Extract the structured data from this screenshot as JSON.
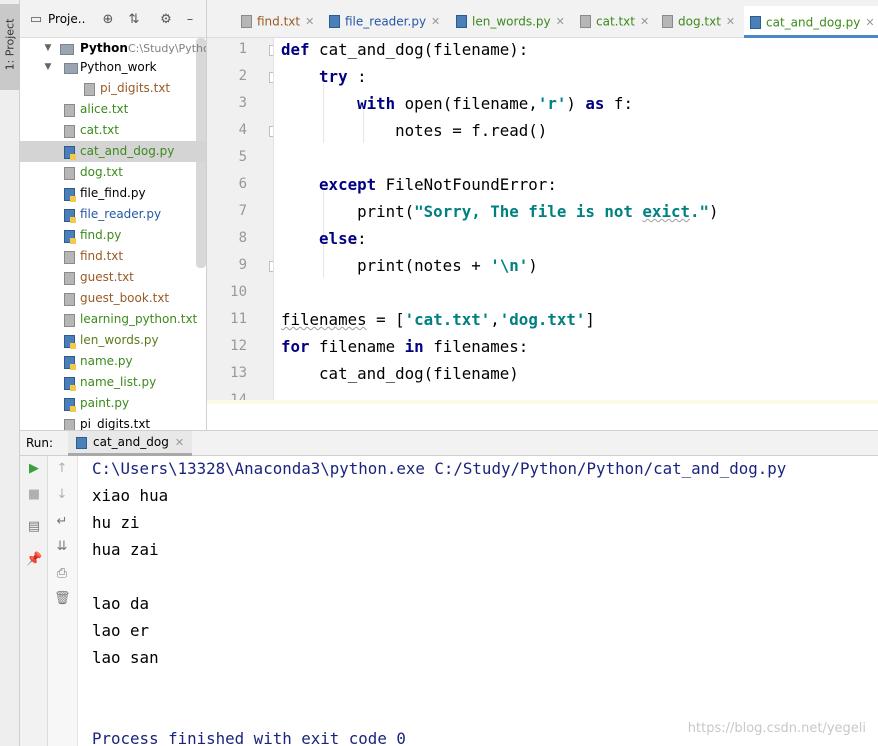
{
  "sidebar": {
    "tab_label": "1: Project"
  },
  "project_panel": {
    "title": "Proje..",
    "tree": [
      {
        "label": "Python",
        "extra": "C:\\Study\\Python\\",
        "kind": "root"
      },
      {
        "label": "Python_work",
        "kind": "folder"
      },
      {
        "label": "pi_digits.txt",
        "kind": "txt"
      },
      {
        "label": "alice.txt",
        "kind": "txt"
      },
      {
        "label": "cat.txt",
        "kind": "txt"
      },
      {
        "label": "cat_and_dog.py",
        "kind": "py",
        "selected": true
      },
      {
        "label": "dog.txt",
        "kind": "txt"
      },
      {
        "label": "file_find.py",
        "kind": "py"
      },
      {
        "label": "file_reader.py",
        "kind": "py"
      },
      {
        "label": "find.py",
        "kind": "py"
      },
      {
        "label": "find.txt",
        "kind": "txt"
      },
      {
        "label": "guest.txt",
        "kind": "txt"
      },
      {
        "label": "guest_book.txt",
        "kind": "txt"
      },
      {
        "label": "learning_python.txt",
        "kind": "txt"
      },
      {
        "label": "len_words.py",
        "kind": "py"
      },
      {
        "label": "name.py",
        "kind": "py"
      },
      {
        "label": "name_list.py",
        "kind": "py"
      },
      {
        "label": "paint.py",
        "kind": "py"
      },
      {
        "label": "pi_digits.txt",
        "kind": "txt"
      }
    ]
  },
  "tabs": [
    {
      "label": "find.txt",
      "kind": "txt"
    },
    {
      "label": "file_reader.py",
      "kind": "py"
    },
    {
      "label": "len_words.py",
      "kind": "py"
    },
    {
      "label": "cat.txt",
      "kind": "txt"
    },
    {
      "label": "dog.txt",
      "kind": "txt"
    },
    {
      "label": "cat_and_dog.py",
      "kind": "py",
      "active": true
    }
  ],
  "editor": {
    "line_numbers": [
      "1",
      "2",
      "3",
      "4",
      "5",
      "6",
      "7",
      "8",
      "9",
      "10",
      "11",
      "12",
      "13",
      "14"
    ]
  },
  "run": {
    "label": "Run:",
    "tab": "cat_and_dog",
    "output": [
      "C:\\Users\\13328\\Anaconda3\\python.exe C:/Study/Python/Python/cat_and_dog.py",
      "xiao hua",
      "hu zi",
      "hua zai",
      "",
      "lao da",
      "lao er",
      "lao san",
      "",
      "",
      "Process finished with exit code 0"
    ]
  },
  "watermark": "https://blog.csdn.net/yegeli",
  "colors": {
    "keyword": "#000080",
    "string": "#008080",
    "selection": "#d4d4d4",
    "active_tab_underline": "#4a88c7"
  }
}
